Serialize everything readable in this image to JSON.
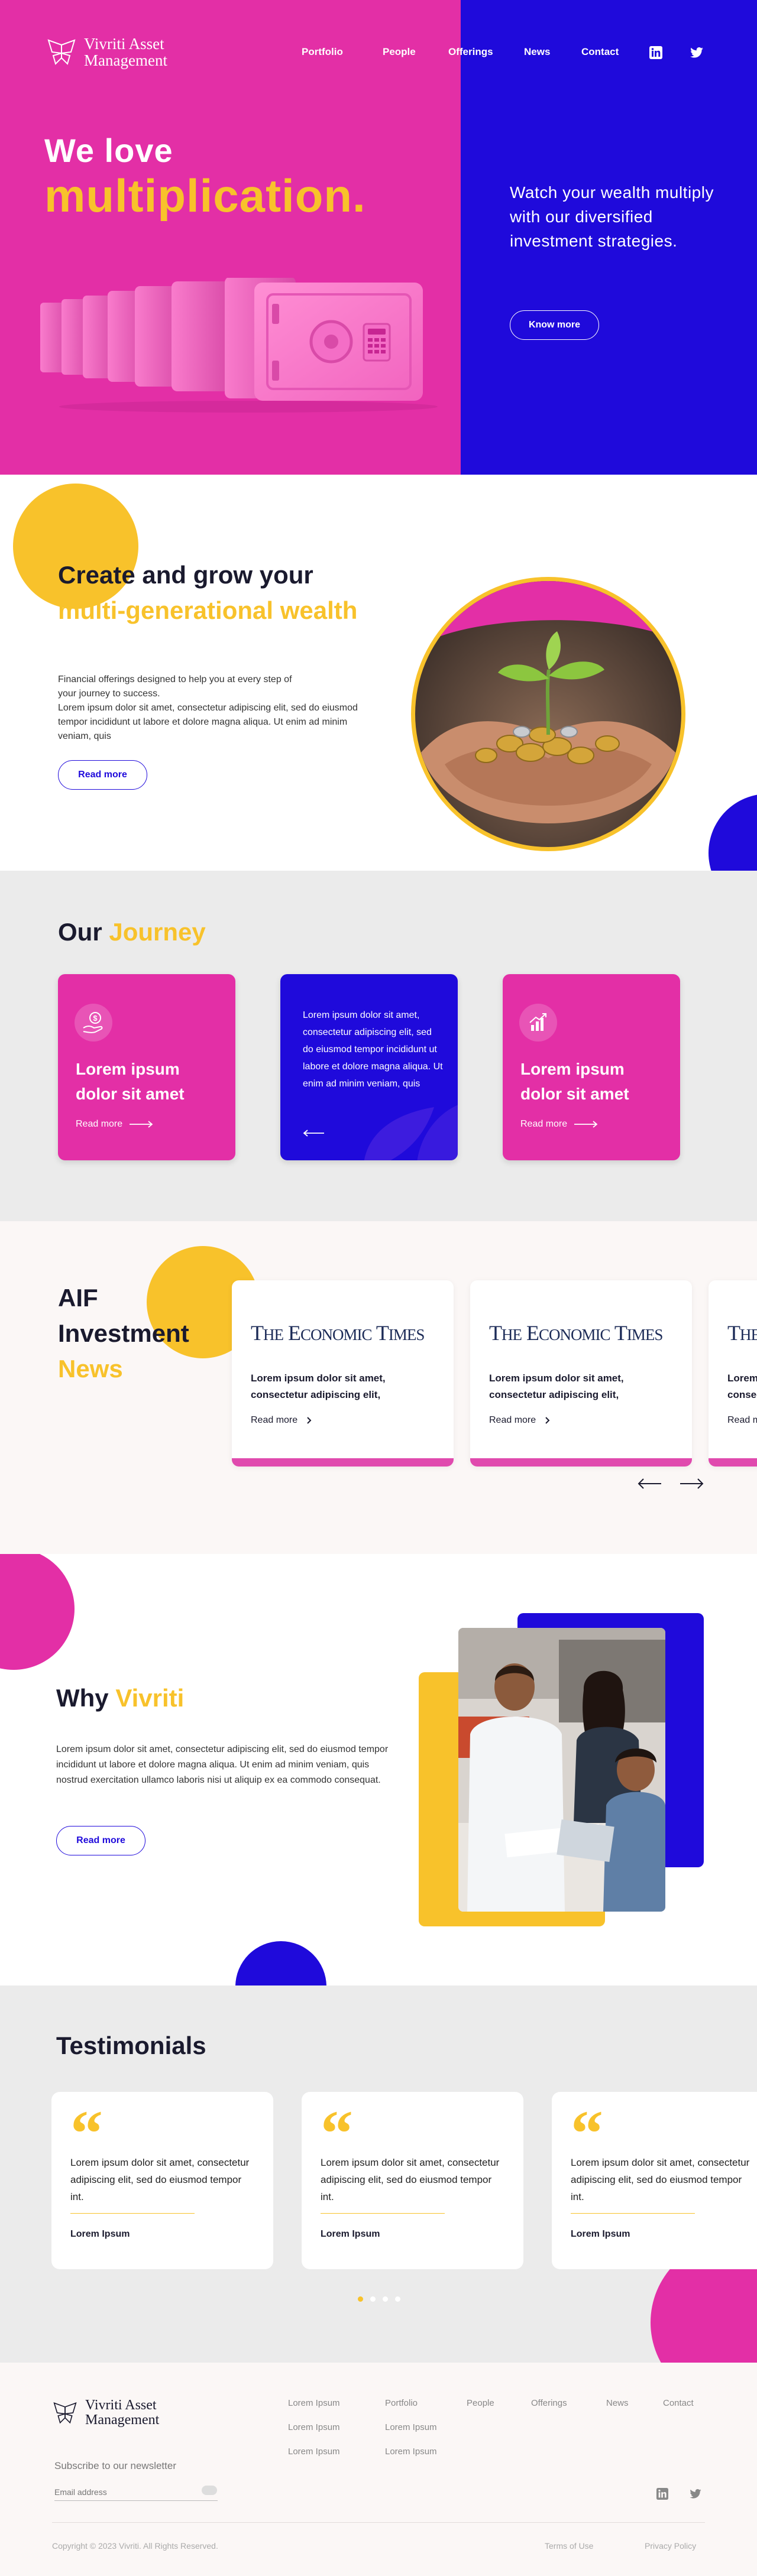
{
  "brand": {
    "name_line1": "Vivriti Asset",
    "name_line2": "Management"
  },
  "nav": {
    "items": [
      "Portfolio",
      "People",
      "Offerings",
      "News",
      "Contact"
    ],
    "social": [
      "linkedin-icon",
      "twitter-icon"
    ]
  },
  "hero": {
    "headline_1": "We love",
    "headline_2": "multiplication.",
    "subtitle": "Watch your wealth multiply with our diversified investment strategies.",
    "cta": "Know more",
    "colors": {
      "pink": "#e32fa6",
      "blue": "#1f0adb",
      "yellow": "#f8c22b"
    }
  },
  "create": {
    "title_1": "Create and grow your",
    "title_2": "multi-generational wealth",
    "intro": "Financial offerings designed to help you at every step of your journey to success.",
    "body": "Lorem ipsum dolor sit amet, consectetur adipiscing elit, sed do eiusmod tempor incididunt ut labore et dolore magna aliqua. Ut enim ad minim veniam, quis",
    "cta": "Read more"
  },
  "journey": {
    "title_1": "Our",
    "title_2": "Journey",
    "cards": [
      {
        "icon": "money-hand-icon",
        "title": "Lorem ipsum dolor sit amet",
        "read_more": "Read more"
      },
      {
        "body": "Lorem ipsum dolor sit amet, consectetur adipiscing elit, sed do eiusmod tempor incididunt ut labore et dolore magna aliqua. Ut enim ad minim veniam, quis"
      },
      {
        "icon": "growth-chart-icon",
        "title": "Lorem ipsum dolor sit amet",
        "read_more": "Read more"
      }
    ]
  },
  "news": {
    "title_1": "AIF",
    "title_2": "Investment",
    "title_3": "News",
    "cards": [
      {
        "source": "The Economic Times",
        "text": "Lorem ipsum dolor sit amet, consectetur adipiscing elit,",
        "read_more": "Read more"
      },
      {
        "source": "The Economic Times",
        "text": "Lorem ipsum dolor sit amet, consectetur adipiscing elit,",
        "read_more": "Read more"
      },
      {
        "source": "The Economic Times",
        "text": "Lorem ipsum dolor sit amet, consectetur adipiscing elit,",
        "read_more": "Read more"
      }
    ]
  },
  "why": {
    "title_1": "Why",
    "title_2": "Vivriti",
    "body": "Lorem ipsum dolor sit amet, consectetur adipiscing elit, sed do eiusmod tempor incididunt ut labore et dolore magna aliqua. Ut enim ad minim veniam, quis nostrud exercitation ullamco laboris nisi ut aliquip ex ea commodo consequat.",
    "cta": "Read more"
  },
  "testimonials": {
    "title": "Testimonials",
    "quote_mark": "“",
    "cards": [
      {
        "text": "Lorem ipsum dolor sit amet, consectetur adipiscing elit, sed do eiusmod tempor int.",
        "name": "Lorem Ipsum"
      },
      {
        "text": "Lorem ipsum dolor sit amet, consectetur adipiscing elit, sed do eiusmod tempor int.",
        "name": "Lorem Ipsum"
      },
      {
        "text": "Lorem ipsum dolor sit amet, consectetur adipiscing elit, sed do eiusmod tempor int.",
        "name": "Lorem Ipsum"
      }
    ],
    "pages": 4,
    "active_page": 1
  },
  "footer": {
    "subscribe": "Subscribe to our newsletter",
    "email_placeholder": "Email address",
    "col1": [
      "Lorem Ipsum",
      "Lorem Ipsum",
      "Lorem Ipsum"
    ],
    "col2": [
      "Portfolio",
      "Lorem Ipsum",
      "Lorem Ipsum"
    ],
    "nav": [
      "People",
      "Offerings",
      "News",
      "Contact"
    ],
    "copyright": "Copyright © 2023 Vivriti. All Rights Reserved.",
    "terms": "Terms of Use",
    "privacy": "Privacy Policy"
  }
}
